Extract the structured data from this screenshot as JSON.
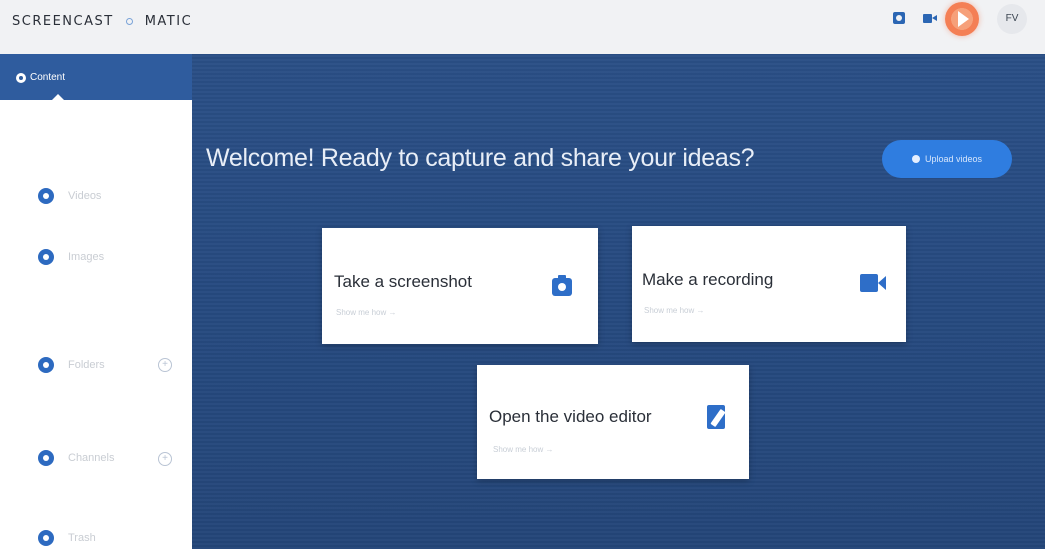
{
  "header": {
    "logo_left": "SCREENCAST",
    "logo_right": "MATIC",
    "user_initials": "FV",
    "icons": [
      "screenshot-icon",
      "record-icon",
      "app-avatar-icon",
      "user-avatar"
    ]
  },
  "sidebar": {
    "header_label": "Content",
    "items": [
      {
        "label": "Videos",
        "icon": "bullet-icon"
      },
      {
        "label": "Images",
        "icon": "bullet-icon"
      },
      {
        "label": "Folders",
        "icon": "bullet-icon",
        "has_add": true
      },
      {
        "label": "Channels",
        "icon": "bullet-icon",
        "has_add": true
      },
      {
        "label": "Trash",
        "icon": "bullet-icon"
      }
    ]
  },
  "main": {
    "welcome": "Welcome! Ready to capture and share your ideas?",
    "upload_label": "Upload videos",
    "cards": [
      {
        "title": "Take a screenshot",
        "sub": "Show me how →",
        "icon": "camera-icon"
      },
      {
        "title": "Make a recording",
        "sub": "Show me how →",
        "icon": "video-camera-icon"
      },
      {
        "title": "Open the video editor",
        "sub": "Show me how →",
        "icon": "edit-icon"
      }
    ]
  },
  "colors": {
    "main_background": "#264a80",
    "sidebar_header": "#2f5c9e",
    "accent": "#2e6ec8",
    "upload_button": "#2f7de0",
    "avatar_orange": "#f47f55"
  }
}
